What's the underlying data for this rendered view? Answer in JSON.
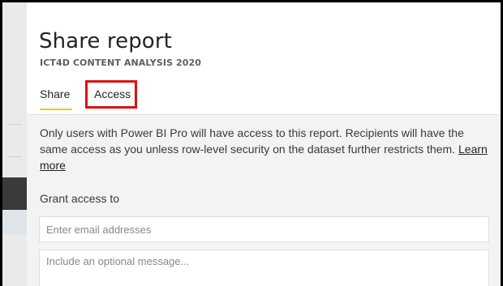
{
  "dialog": {
    "title": "Share report",
    "subtitle": "ICT4D CONTENT ANALYSIS 2020",
    "tabs": [
      {
        "label": "Share",
        "active": true
      },
      {
        "label": "Access",
        "active": false,
        "highlighted": true
      }
    ],
    "info_text": "Only users with Power BI Pro will have access to this report. Recipients will have the same access as you unless row-level security on the dataset further restricts them.",
    "learn_more": "Learn more",
    "grant_label": "Grant access to",
    "email_placeholder": "Enter email addresses",
    "message_placeholder": "Include an optional message..."
  },
  "colors": {
    "accent_underline": "#f2c811",
    "highlight_box": "#e01010",
    "panel_bg": "#f3f3f3",
    "header_bg": "#ffffff"
  }
}
